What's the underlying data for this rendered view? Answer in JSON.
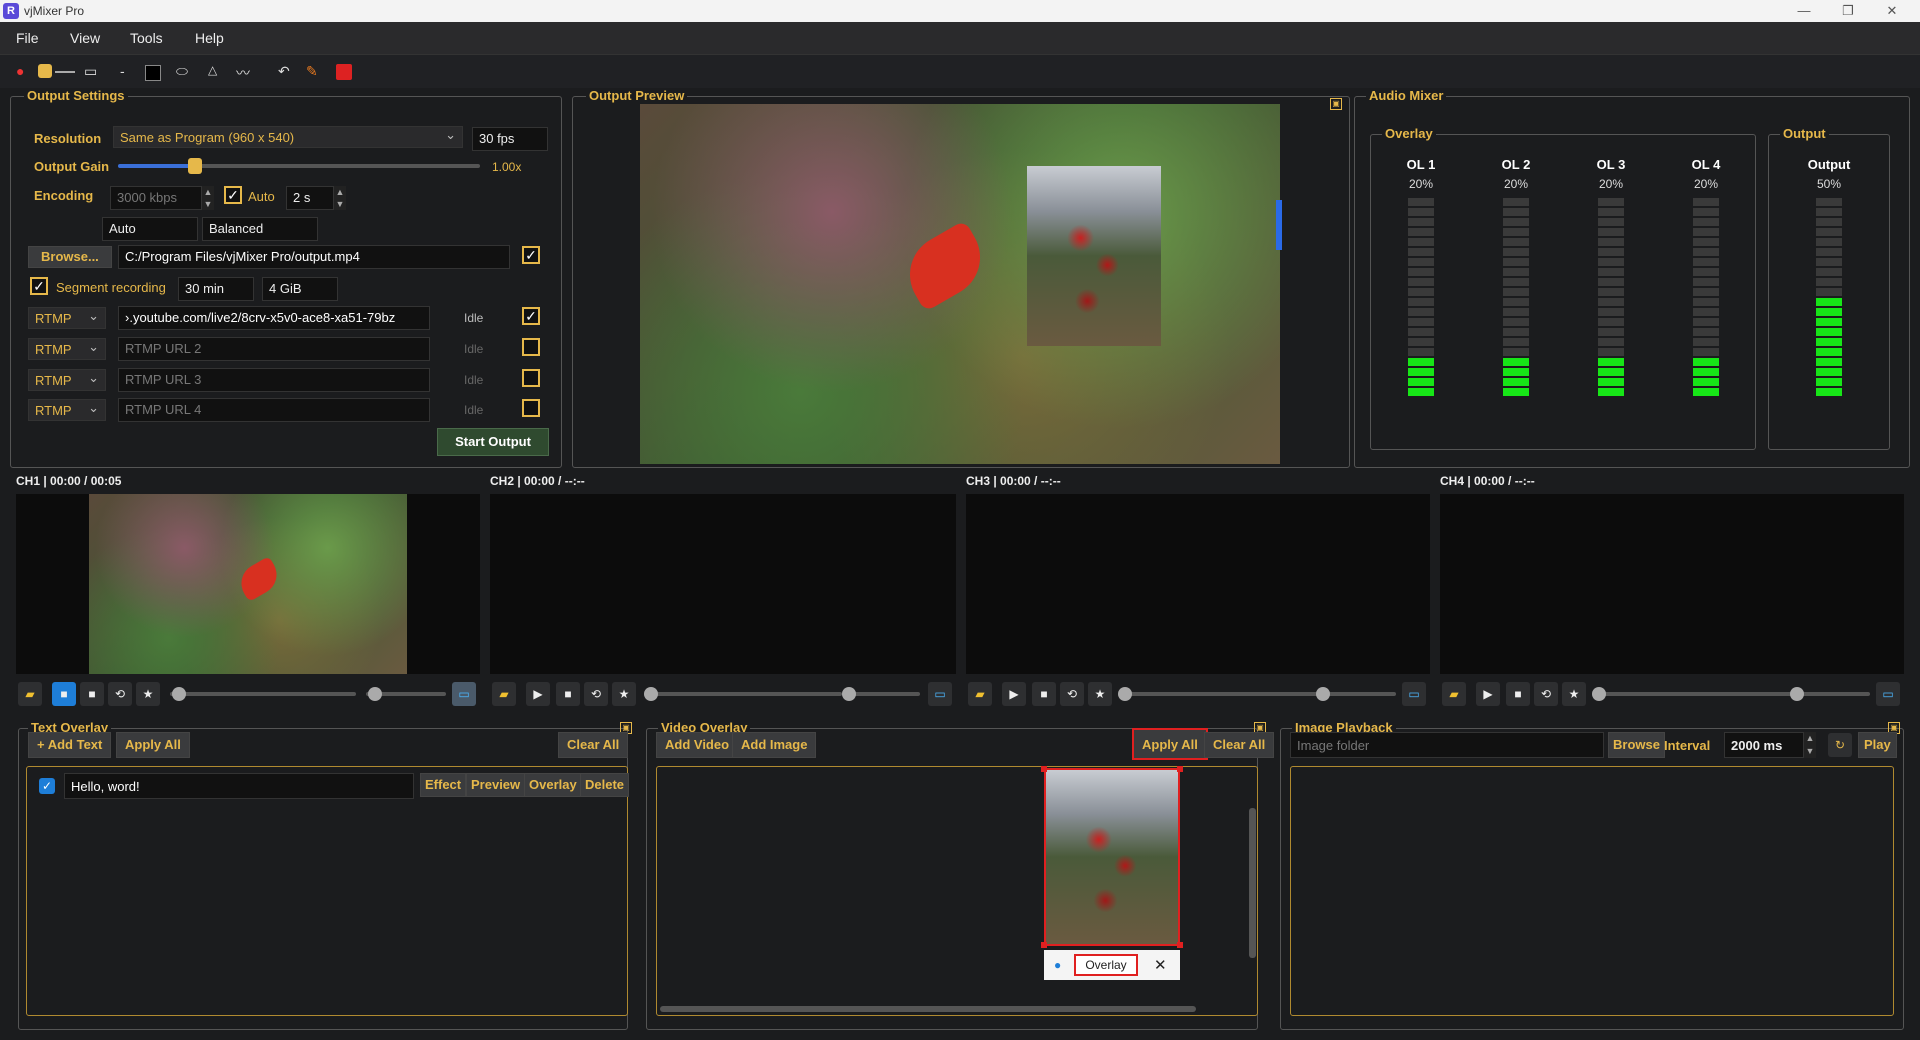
{
  "app": {
    "title": "vjMixer Pro"
  },
  "menu": [
    "File",
    "View",
    "Tools",
    "Help"
  ],
  "output_settings": {
    "title": "Output Settings",
    "resolution_label": "Resolution",
    "resolution_value": "Same as Program (960 x 540)",
    "fps": "30 fps",
    "gain_label": "Output Gain",
    "gain_value": "1.00x",
    "gain_fraction": 0.2,
    "encoding_label": "Encoding",
    "bitrate": "3000 kbps",
    "auto_label": "Auto",
    "keyframe": "2 s",
    "preset1": "Auto",
    "preset2": "Balanced",
    "browse_label": "Browse...",
    "path": "C:/Program Files/vjMixer Pro/output.mp4",
    "segment_label": "Segment recording",
    "segment_time": "30 min",
    "segment_size": "4 GiB",
    "streams": [
      {
        "protocol": "RTMP",
        "url": "›.youtube.com/live2/8crv-x5v0-ace8-xa51-79bz",
        "status": "Idle",
        "checked": true
      },
      {
        "protocol": "RTMP",
        "url": "RTMP URL 2",
        "status": "Idle",
        "checked": false
      },
      {
        "protocol": "RTMP",
        "url": "RTMP URL 3",
        "status": "Idle",
        "checked": false
      },
      {
        "protocol": "RTMP",
        "url": "RTMP URL 4",
        "status": "Idle",
        "checked": false
      }
    ],
    "start_label": "Start Output"
  },
  "output_preview": {
    "title": "Output Preview"
  },
  "audio_mixer": {
    "title": "Audio Mixer",
    "overlay_group": "Overlay",
    "output_group": "Output",
    "channels": [
      {
        "name": "OL 1",
        "pct": "20%",
        "level": 0.2
      },
      {
        "name": "OL 2",
        "pct": "20%",
        "level": 0.2
      },
      {
        "name": "OL 3",
        "pct": "20%",
        "level": 0.2
      },
      {
        "name": "OL 4",
        "pct": "20%",
        "level": 0.2
      }
    ],
    "output": {
      "name": "Output",
      "pct": "50%",
      "level": 0.5
    }
  },
  "channels": [
    {
      "label": "CH1 | 00:00 / 00:05"
    },
    {
      "label": "CH2 | 00:00 / --:--"
    },
    {
      "label": "CH3 | 00:00 / --:--"
    },
    {
      "label": "CH4 | 00:00 / --:--"
    }
  ],
  "text_overlay": {
    "title": "Text Overlay",
    "add_label": "+ Add Text",
    "apply_label": "Apply All",
    "clear_label": "Clear All",
    "items": [
      {
        "text": "Hello, word!",
        "actions": [
          "Effect",
          "Preview",
          "Overlay",
          "Delete"
        ]
      }
    ]
  },
  "video_overlay": {
    "title": "Video Overlay",
    "add_video": "Add Video",
    "add_image": "Add Image",
    "apply_label": "Apply All",
    "clear_label": "Clear All",
    "item_label": "Overlay",
    "close": "✕"
  },
  "image_playback": {
    "title": "Image Playback",
    "folder_placeholder": "Image folder",
    "browse_label": "Browse",
    "interval_label": "Interval",
    "interval_value": "2000 ms",
    "play_label": "Play"
  }
}
